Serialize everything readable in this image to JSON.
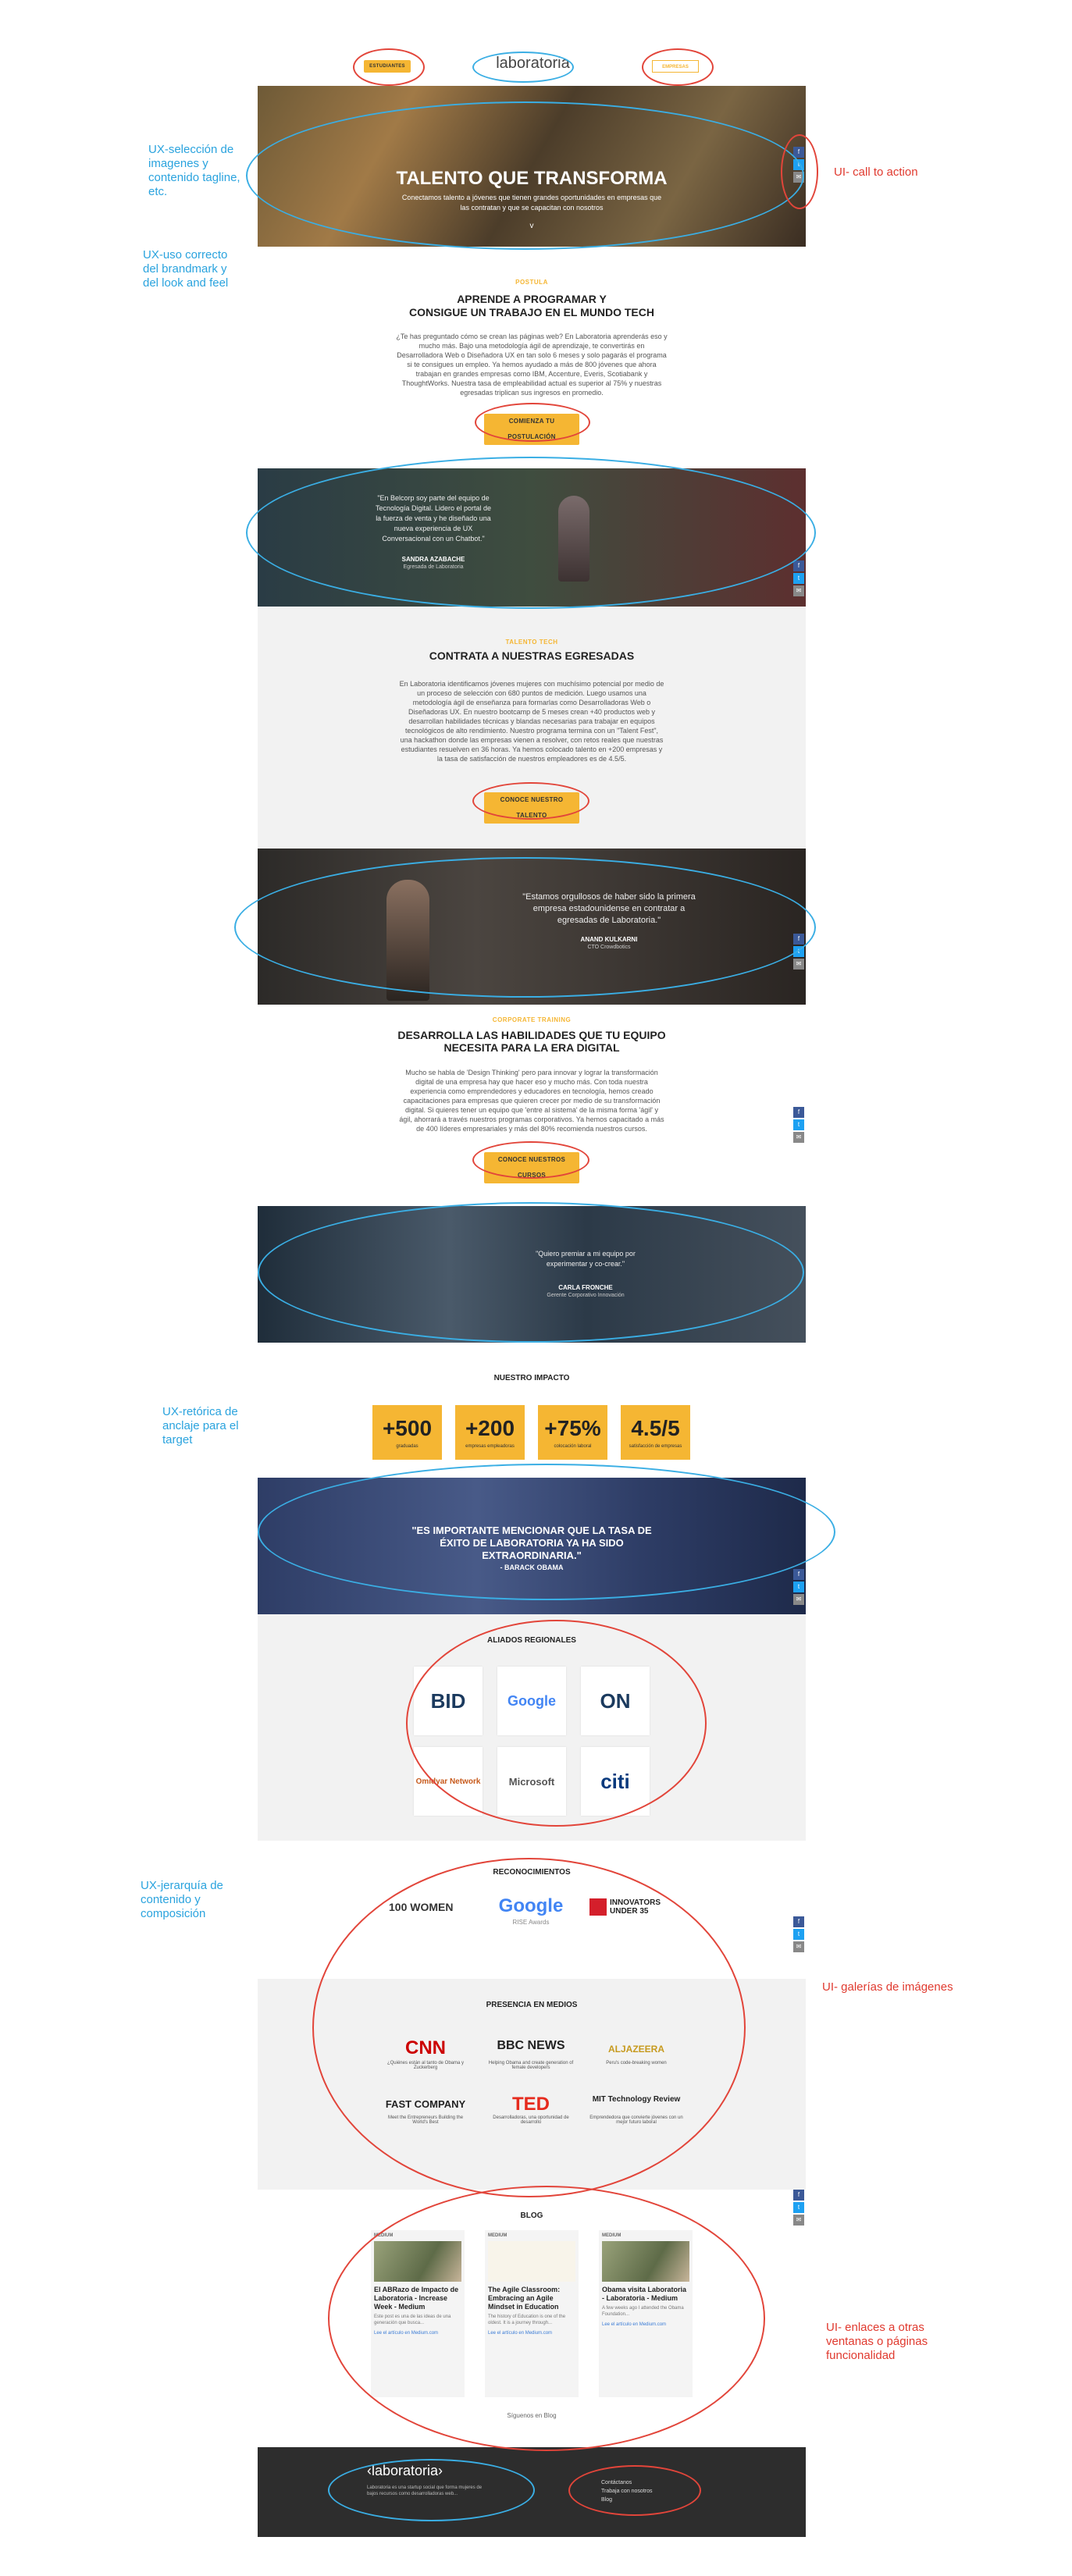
{
  "header": {
    "left_button": "ESTUDIANTES",
    "logo": "laboratoria",
    "right_button": "EMPRESAS"
  },
  "hero": {
    "title": "TALENTO QUE TRANSFORMA",
    "subtitle_line1": "Conectamos talento a jóvenes que tienen grandes oportunidades en empresas que",
    "subtitle_line2": "las contratan y que se capacitan con nosotros"
  },
  "social": [
    "f",
    "t",
    "✉"
  ],
  "postula": {
    "kicker": "POSTULA",
    "title_line1": "APRENDE A PROGRAMAR Y",
    "title_line2": "CONSIGUE UN TRABAJO EN EL MUNDO TECH",
    "body": [
      "¿Te has preguntado cómo se crean las páginas web? En Laboratoria aprenderás eso y",
      "mucho más. Bajo una metodología ágil de aprendizaje, te convertirás en",
      "Desarrolladora Web o Diseñadora UX en tan solo 6 meses y solo pagarás el programa",
      "si te consigues un empleo. Ya hemos ayudado a más de 800 jóvenes que ahora",
      "trabajan en grandes empresas como IBM, Accenture, Everis, Scotiabank y",
      "ThoughtWorks. Nuestra tasa de empleabilidad actual es superior al 75% y nuestras",
      "egresadas triplican sus ingresos en promedio."
    ],
    "button": "COMIENZA TU POSTULACIÓN"
  },
  "testimonial1": {
    "quote": [
      "\"En Belcorp soy parte del equipo de",
      "Tecnología Digital. Lidero el portal de",
      "la fuerza de venta y he diseñado una",
      "nueva experiencia de UX",
      "Conversacional con un Chatbot.\""
    ],
    "name": "SANDRA AZABACHE",
    "role": "Egresada de Laboratoria"
  },
  "talento": {
    "kicker": "TALENTO TECH",
    "title": "CONTRATA A NUESTRAS EGRESADAS",
    "body": [
      "En Laboratoria identificamos jóvenes mujeres con muchísimo potencial por medio de",
      "un proceso de selección con 680 puntos de medición. Luego usamos una",
      "metodología ágil de enseñanza para formarlas como Desarrolladoras Web o",
      "Diseñadoras UX. En nuestro bootcamp de 5 meses crean +40 productos web y",
      "desarrollan habilidades técnicas y blandas necesarias para trabajar en equipos",
      "tecnológicos de alto rendimiento. Nuestro programa termina con un \"Talent Fest\",",
      "una hackathon donde las empresas vienen a resolver, con retos reales que nuestras",
      "estudiantes resuelven en 36 horas. Ya hemos colocado talento en +200 empresas y",
      "la tasa de satisfacción de nuestros empleadores es de 4.5/5."
    ],
    "button": "CONOCE NUESTRO TALENTO"
  },
  "testimonial2": {
    "quote": [
      "\"Estamos orgullosos de haber sido la primera",
      "empresa estadounidense en contratar a",
      "egresadas de Laboratoria.\""
    ],
    "name": "ANAND KULKARNI",
    "role": "CTO Crowdbotics"
  },
  "corporate": {
    "kicker": "CORPORATE TRAINING",
    "title_line1": "DESARROLLA LAS HABILIDADES QUE TU EQUIPO",
    "title_line2": "NECESITA PARA LA ERA DIGITAL",
    "body": [
      "Mucho se habla de 'Design Thinking' pero para innovar y lograr la transformación",
      "digital de una empresa hay que hacer eso y mucho más. Con toda nuestra",
      "experiencia como emprendedores y educadores en tecnología, hemos creado",
      "capacitaciones para empresas que quieren crecer por medio de su transformación",
      "digital. Si quieres tener un equipo que 'entre al sistema' de la misma forma 'ágil' y",
      "ágil, ahorrará a través nuestros programas corporativos. Ya hemos capacitado a más",
      "de 400 líderes empresariales y más del 80% recomienda nuestros cursos."
    ],
    "button": "CONOCE NUESTROS CURSOS"
  },
  "testimonial3": {
    "quote": [
      "\"Quiero premiar a mi equipo por",
      "experimentar y co-crear.\""
    ],
    "name": "CARLA FRONCHE",
    "role": "Gerente Corporativo Innovación"
  },
  "impact": {
    "title": "NUESTRO IMPACTO",
    "stats": [
      {
        "value": "+500",
        "label": "graduadas"
      },
      {
        "value": "+200",
        "label": "empresas empleadoras"
      },
      {
        "value": "+75%",
        "label": "colocación laboral"
      },
      {
        "value": "4.5/5",
        "label": "satisfacción de empresas"
      }
    ]
  },
  "obama": {
    "quote_line1": "\"ES IMPORTANTE MENCIONAR QUE LA TASA DE",
    "quote_line2": "ÉXITO DE LABORATORIA YA HA SIDO",
    "quote_line3": "EXTRAORDINARIA.\"",
    "author": "- BARACK OBAMA"
  },
  "allies": {
    "title": "ALIADOS REGIONALES",
    "logos": [
      "BID",
      "Google",
      "ON",
      "Omidyar Network",
      "Microsoft",
      "citi"
    ]
  },
  "recognition": {
    "title": "RECONOCIMIENTOS",
    "items": [
      "100 WOMEN",
      "Google",
      "RISE Awards",
      "INNOVATORS UNDER 35"
    ]
  },
  "media": {
    "title": "PRESENCIA EN MEDIOS",
    "items": [
      {
        "logo": "CNN",
        "caption": "¿Quiénes están al tanto de Obama y Zuckerberg"
      },
      {
        "logo": "BBC NEWS",
        "caption": "Helping Obama and create generation of female developers"
      },
      {
        "logo": "ALJAZEERA",
        "caption": "Peru's code-breaking women"
      },
      {
        "logo": "FAST COMPANY",
        "caption": "Meet the Entrepreneurs Building the World's Best"
      },
      {
        "logo": "TED",
        "caption": "Desarrolladoras, una oportunidad de desarrollo"
      },
      {
        "logo": "MIT Technology Review",
        "caption": "Emprendedora que convierte jóvenes con un mejor futuro laboral"
      }
    ]
  },
  "blog": {
    "title": "BLOG",
    "posts": [
      {
        "header": "MEDIUM",
        "title": "El ABRazo de Impacto de Laboratoria - Increase Week - Medium",
        "summary": "Este post es una de las ideas de una generación que busca...",
        "link": "Lee el artículo en Medium.com"
      },
      {
        "header": "MEDIUM",
        "title": "The Agile Classroom: Embracing an Agile Mindset in Education",
        "summary": "The history of Education is one of the oldest. It is a journey through...",
        "link": "Lee el artículo en Medium.com"
      },
      {
        "header": "MEDIUM",
        "title": "Obama visita Laboratoria - Laboratoria - Medium",
        "summary": "A few weeks ago I attended the Obama Foundation...",
        "link": "Lee el artículo en Medium.com"
      }
    ],
    "follow": "Síguenos en Blog"
  },
  "footer": {
    "logo": "‹laboratoria›",
    "tagline": [
      "Laboratoria es una startup social que forma mujeres de",
      "bajos recursos como desarrolladoras web..."
    ],
    "links": [
      "Contáctanos",
      "Trabaja con nosotros",
      "Blog"
    ]
  },
  "annotations": {
    "ux_images": "UX-selección de imagenes y contenido tagline, etc.",
    "ui_cta": "UI- call to action",
    "ux_brand": "UX-uso correcto del brandmark y del look and feel",
    "ux_rhetoric": "UX-retórica de anclaje para el target",
    "ux_hierarchy": "UX-jerarquía de contenido y composición",
    "ui_galleries": "UI- galerías de imágenes",
    "ui_links": "UI- enlaces a otras ventanas o páginas funcionalidad"
  }
}
